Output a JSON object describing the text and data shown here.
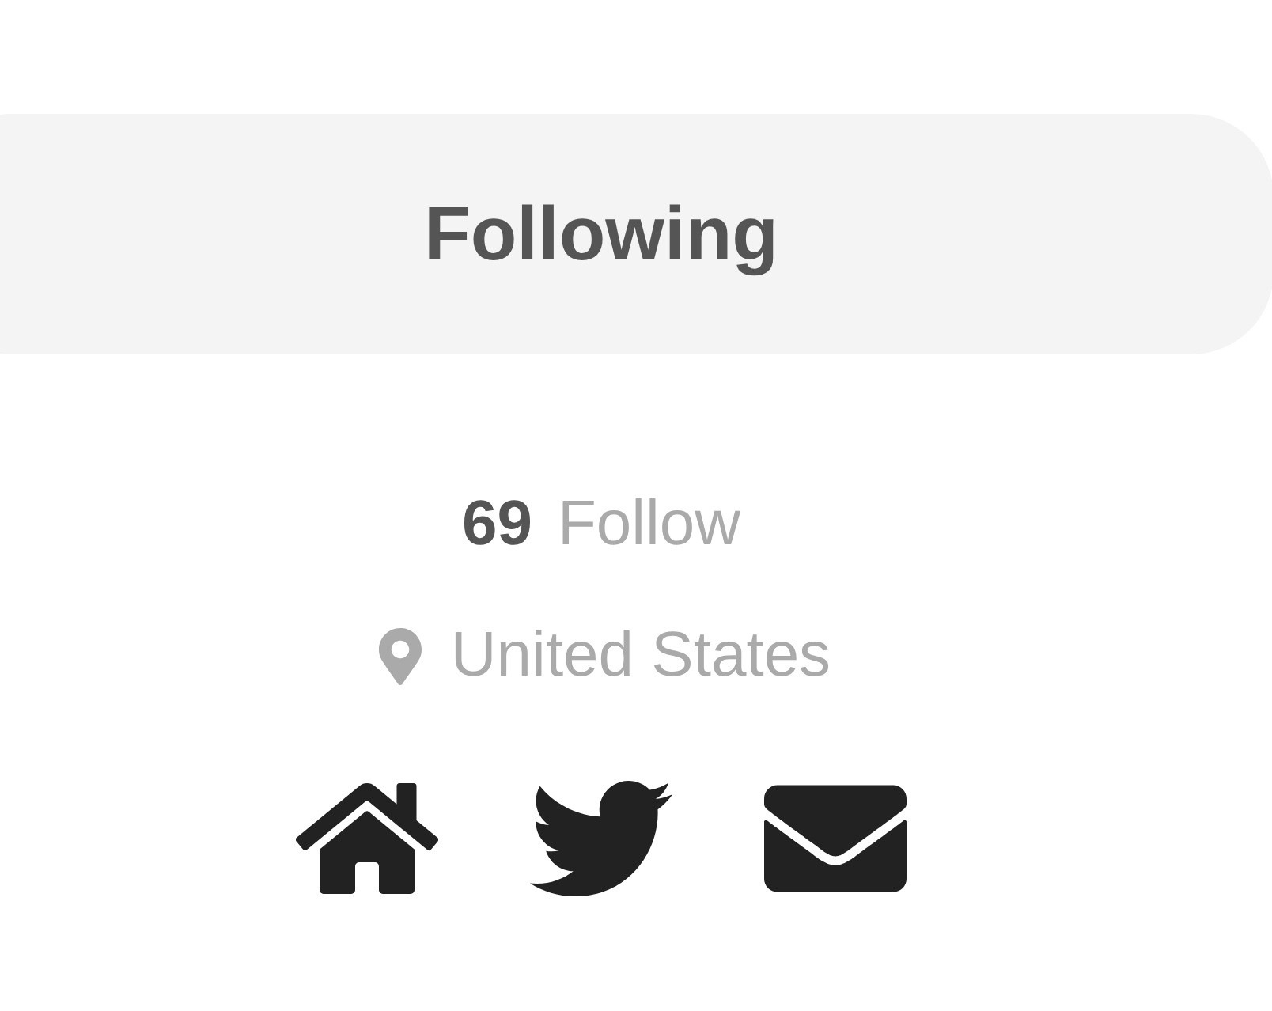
{
  "follow_button": {
    "label": "Following"
  },
  "stats": {
    "count": "69",
    "label": "Follow"
  },
  "location": "United States"
}
